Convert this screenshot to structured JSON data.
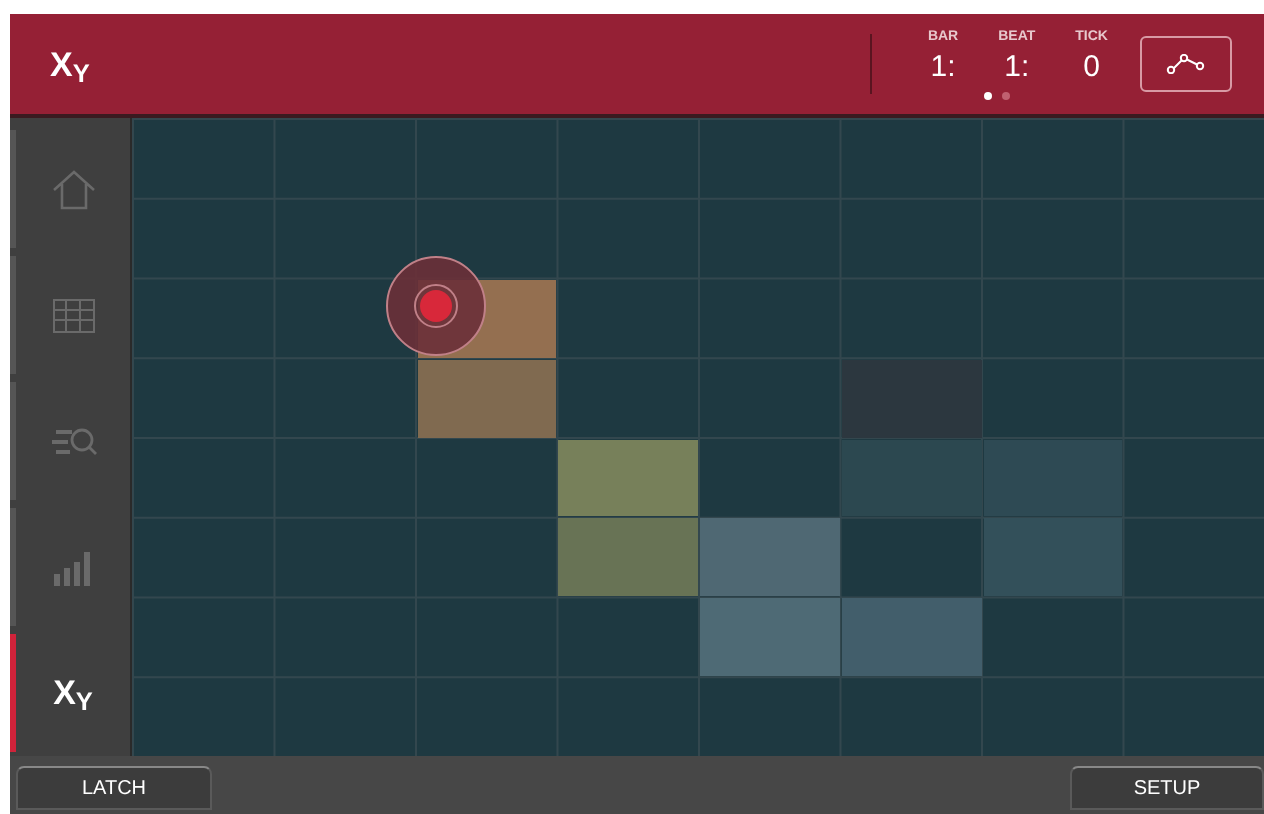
{
  "header": {
    "logo": "X$_{Y}$",
    "transport": [
      {
        "label": "BAR",
        "value": "1:"
      },
      {
        "label": "BEAT",
        "value": "1:"
      },
      {
        "label": "TICK",
        "value": "0"
      }
    ],
    "pages": [
      {
        "selected": true
      },
      {
        "selected": false
      }
    ]
  },
  "sidebar": {
    "items": [
      {
        "kind": "home",
        "selected": false
      },
      {
        "kind": "grid",
        "selected": false
      },
      {
        "kind": "search",
        "selected": false
      },
      {
        "kind": "levels",
        "selected": false
      },
      {
        "kind": "text",
        "label": "X$_{Y}$",
        "selected": true
      }
    ]
  },
  "bottom_bar": {
    "left_button": "LATCH",
    "right_button": "SETUP"
  }
}
